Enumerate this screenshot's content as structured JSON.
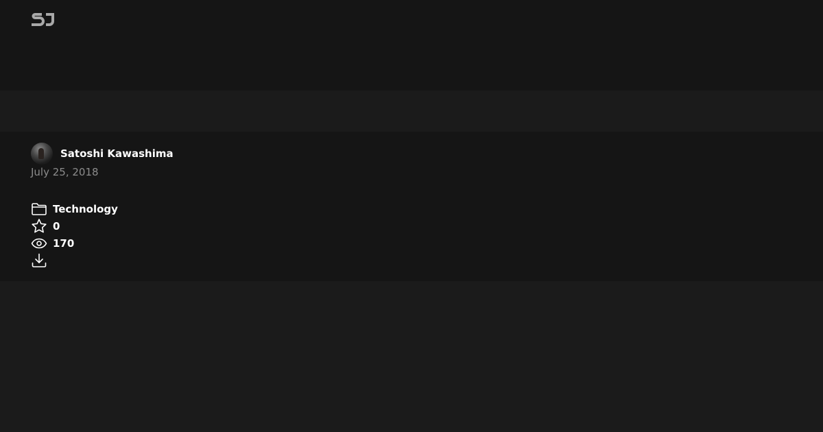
{
  "header": {
    "logo_icon": "sj-logo-icon"
  },
  "post": {
    "author": "Satoshi Kawashima",
    "date": "July 25, 2018",
    "category": "Technology",
    "stars": "0",
    "views": "170"
  },
  "icons": {
    "category": "folder-icon",
    "stars": "star-icon",
    "views": "eye-icon",
    "download": "download-icon"
  },
  "colors": {
    "background": "#1b1b1b",
    "panel": "#151515",
    "text": "#ffffff",
    "muted": "#8c8c8c"
  }
}
